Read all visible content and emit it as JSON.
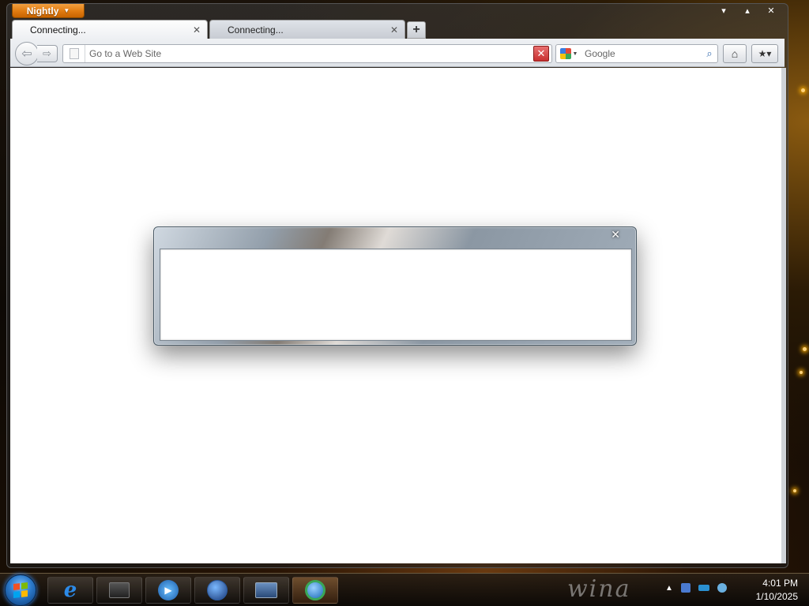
{
  "browser": {
    "app_button_label": "Nightly",
    "tabs": [
      {
        "title": "Connecting...",
        "active": true
      },
      {
        "title": "Connecting...",
        "active": false
      }
    ],
    "new_tab_icon": "plus-icon",
    "url_placeholder": "Go to a Web Site",
    "search_placeholder": "Google",
    "stop_color": "#c83030"
  },
  "dialog": {
    "close_icon": "close-icon",
    "body_text": ""
  },
  "taskbar": {
    "apps": [
      "internet-explorer",
      "folder",
      "media-player",
      "globe",
      "display-settings",
      "firefox"
    ],
    "wallpaper_brand": "wina",
    "clock": {
      "time": "4:01 PM",
      "date": "1/10/2025"
    }
  }
}
